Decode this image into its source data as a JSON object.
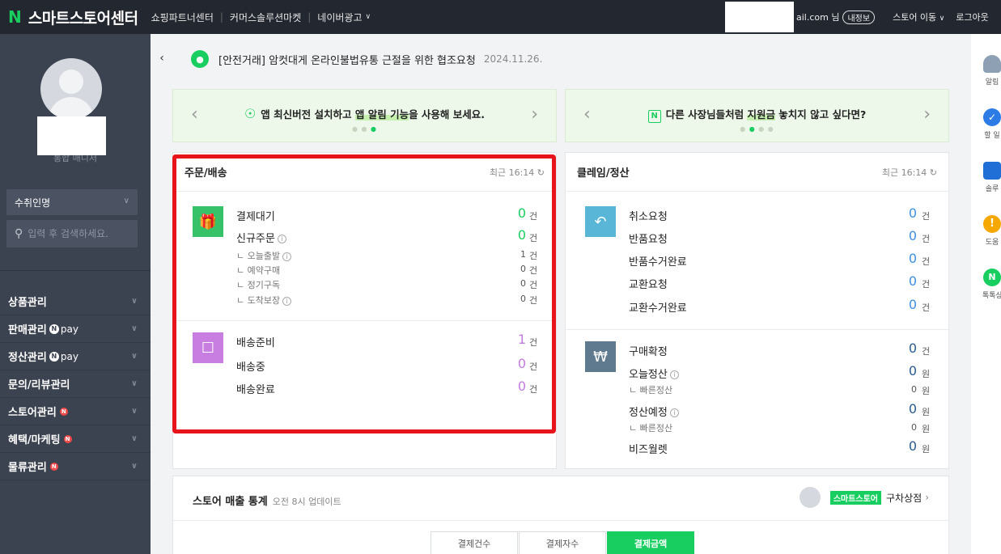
{
  "topbar": {
    "logo_n": "N",
    "logo_text": "스마트스토어센터",
    "nav": [
      "쇼핑파트너센터",
      "커머스솔루션마켓",
      "네이버광고"
    ],
    "user_suffix": "ail.com 님",
    "info_badge": "내정보",
    "store_move": "스토어 이동",
    "logout": "로그아웃"
  },
  "sidebar": {
    "role": "통합 매니저",
    "select_value": "수취인명",
    "search_placeholder": "입력 후 검색하세요.",
    "menu": [
      {
        "label": "상품관리"
      },
      {
        "label": "판매관리",
        "pay": "pay"
      },
      {
        "label": "정산관리",
        "pay": "pay"
      },
      {
        "label": "문의/리뷰관리"
      },
      {
        "label": "스토어관리",
        "n": "N"
      },
      {
        "label": "혜택/마케팅",
        "n": "N"
      },
      {
        "label": "물류관리",
        "n": "N"
      }
    ]
  },
  "notice": {
    "text": "[안전거래] 암컷대게 온라인불법유통 근절을 위한 협조요청",
    "date": "2024.11.26."
  },
  "banners": {
    "left": {
      "pre": "앱 최신버전 설치하고 ",
      "hl": "앱 알림 기능",
      "post": "을 사용해 보세요."
    },
    "right": {
      "pre": "다른 사장님들처럼 ",
      "hl": "지원금",
      "post": " 놓치지 않고 싶다면?"
    }
  },
  "order": {
    "title": "주문/배송",
    "recent": "최근 16:14",
    "group1": {
      "main": [
        {
          "label": "결제대기",
          "count": "0",
          "unit": "건"
        },
        {
          "label": "신규주문",
          "count": "0",
          "unit": "건",
          "info": true
        }
      ],
      "sub": [
        {
          "label": "오늘출발",
          "count": "1",
          "unit": "건",
          "info": true
        },
        {
          "label": "예약구매",
          "count": "0",
          "unit": "건"
        },
        {
          "label": "정기구독",
          "count": "0",
          "unit": "건"
        },
        {
          "label": "도착보장",
          "count": "0",
          "unit": "건",
          "info": true
        }
      ]
    },
    "group2": [
      {
        "label": "배송준비",
        "count": "1",
        "unit": "건"
      },
      {
        "label": "배송중",
        "count": "0",
        "unit": "건"
      },
      {
        "label": "배송완료",
        "count": "0",
        "unit": "건"
      }
    ]
  },
  "claim": {
    "title": "클레임/정산",
    "recent": "최근 16:14",
    "group1": [
      {
        "label": "취소요청",
        "count": "0",
        "unit": "건"
      },
      {
        "label": "반품요청",
        "count": "0",
        "unit": "건"
      },
      {
        "label": "반품수거완료",
        "count": "0",
        "unit": "건"
      },
      {
        "label": "교환요청",
        "count": "0",
        "unit": "건"
      },
      {
        "label": "교환수거완료",
        "count": "0",
        "unit": "건"
      }
    ],
    "group2": {
      "buy": {
        "label": "구매확정",
        "count": "0",
        "unit": "건"
      },
      "today": {
        "label": "오늘정산",
        "count": "0",
        "unit": "원"
      },
      "today_fast": {
        "label": "빠른정산",
        "count": "0",
        "unit": "원"
      },
      "plan": {
        "label": "정산예정",
        "count": "0",
        "unit": "원"
      },
      "plan_fast": {
        "label": "빠른정산",
        "count": "0",
        "unit": "원"
      },
      "wallet": {
        "label": "비즈월렛",
        "count": "0",
        "unit": "원"
      }
    }
  },
  "rail": [
    "알림",
    "할 일",
    "솔루",
    "도움",
    "톡톡상"
  ],
  "stats": {
    "title": "스토어 매출 통계",
    "sub": "오전 8시 업데이트",
    "tag": "스마트스토어",
    "store": "구차상점",
    "tabs": [
      "결제건수",
      "결제자수",
      "결제금액"
    ],
    "active_tab": "결제금액"
  },
  "colors": {
    "brand": "#19ce60",
    "order_count_green": "#19ce60",
    "delivery_count_purple": "#c47be0",
    "claim_count_blue": "#3d8fe5",
    "highlight_red": "#e8141b"
  }
}
